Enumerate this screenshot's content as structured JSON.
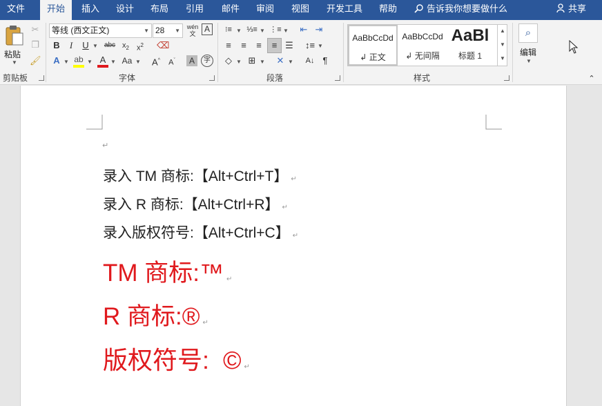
{
  "tabs": [
    {
      "label": "文件"
    },
    {
      "label": "开始"
    },
    {
      "label": "插入"
    },
    {
      "label": "设计"
    },
    {
      "label": "布局"
    },
    {
      "label": "引用"
    },
    {
      "label": "邮件"
    },
    {
      "label": "审阅"
    },
    {
      "label": "视图"
    },
    {
      "label": "开发工具"
    },
    {
      "label": "帮助"
    }
  ],
  "tellme": "告诉我你想要做什么",
  "share": "共享",
  "clipboard": {
    "paste_label": "粘贴",
    "group_label": "剪贴板"
  },
  "font": {
    "name": "等线 (西文正文)",
    "size": "28",
    "group_label": "字体"
  },
  "paragraph": {
    "group_label": "段落"
  },
  "styles": {
    "items": [
      {
        "sample": "AaBbCcDd",
        "name": "正文"
      },
      {
        "sample": "AaBbCcDd",
        "name": "无间隔"
      },
      {
        "sample": "AaBl",
        "name": "标题 1"
      }
    ],
    "group_label": "样式"
  },
  "editing": {
    "label": "编辑"
  },
  "document": {
    "lines": [
      "录入 TM 商标:【Alt+Ctrl+T】",
      "录入 R 商标:【Alt+Ctrl+R】",
      "录入版权符号:【Alt+Ctrl+C】"
    ],
    "red_lines": [
      "TM 商标:™",
      "R 商标:®",
      "版权符号:  ©"
    ],
    "paragraph_mark": "↵"
  },
  "colors": {
    "accent": "#2b579a",
    "red_text": "#e0191d"
  }
}
